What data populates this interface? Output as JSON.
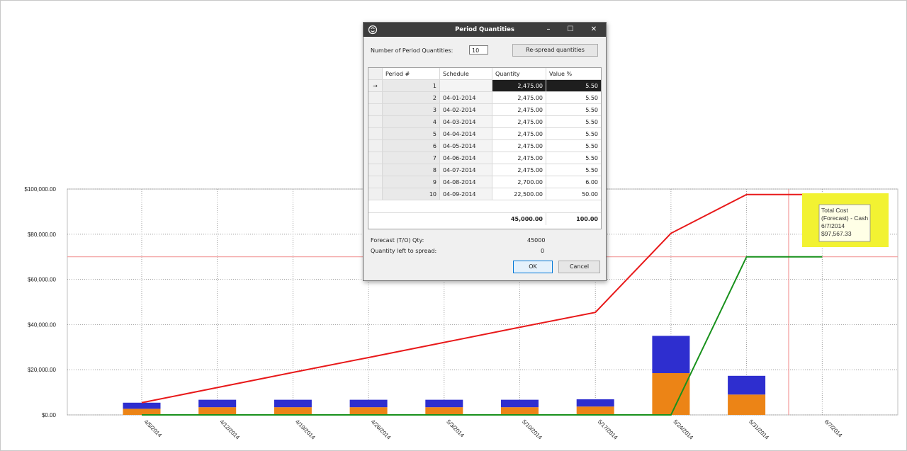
{
  "chart_data": {
    "type": "bar",
    "categories": [
      "4/5/2014",
      "4/12/2014",
      "4/19/2014",
      "4/26/2014",
      "5/3/2014",
      "5/10/2014",
      "5/17/2014",
      "5/24/2014",
      "5/31/2014",
      "6/7/2014"
    ],
    "series": [
      {
        "kind": "bar",
        "color": "#ec8416",
        "values": [
          2700,
          3400,
          3400,
          3400,
          3400,
          3400,
          3700,
          18500,
          9000,
          0
        ]
      },
      {
        "kind": "bar",
        "color": "#2e2ecf",
        "values": [
          2700,
          3300,
          3300,
          3300,
          3300,
          3300,
          3200,
          16500,
          8300,
          0
        ]
      },
      {
        "kind": "line",
        "color": "#e8191a",
        "values": [
          5400,
          12100,
          18800,
          25400,
          32100,
          38800,
          45400,
          80400,
          97567.33,
          97567.33
        ]
      },
      {
        "kind": "line",
        "color": "#18911c",
        "values": [
          0,
          0,
          0,
          0,
          0,
          0,
          0,
          0,
          70000,
          70000
        ]
      }
    ],
    "ylim": [
      0,
      100000
    ],
    "yticks": [
      "$0.00",
      "$20,000.00",
      "$40,000.00",
      "$60,000.00",
      "$80,000.00",
      "$100,000.00"
    ],
    "hline": 70000,
    "cursor_x": 9.6,
    "grid": true,
    "tooltip": {
      "lines": [
        "Total Cost",
        "(Forecast) - Cash",
        "6/7/2014",
        "$97,567.33"
      ],
      "bg": "#f2f232"
    }
  },
  "dialog": {
    "title": "Period Quantities",
    "icon": "app-logo-icon",
    "num_label": "Number of Period Quantities:",
    "num_value": "10",
    "respread_label": "Re-spread quantities",
    "columns": [
      "Period #",
      "Schedule",
      "Quantity",
      "Value %"
    ],
    "rows": [
      {
        "period": "1",
        "schedule": "",
        "quantity": "2,475.00",
        "value": "5.50"
      },
      {
        "period": "2",
        "schedule": "04-01-2014",
        "quantity": "2,475.00",
        "value": "5.50"
      },
      {
        "period": "3",
        "schedule": "04-02-2014",
        "quantity": "2,475.00",
        "value": "5.50"
      },
      {
        "period": "4",
        "schedule": "04-03-2014",
        "quantity": "2,475.00",
        "value": "5.50"
      },
      {
        "period": "5",
        "schedule": "04-04-2014",
        "quantity": "2,475.00",
        "value": "5.50"
      },
      {
        "period": "6",
        "schedule": "04-05-2014",
        "quantity": "2,475.00",
        "value": "5.50"
      },
      {
        "period": "7",
        "schedule": "04-06-2014",
        "quantity": "2,475.00",
        "value": "5.50"
      },
      {
        "period": "8",
        "schedule": "04-07-2014",
        "quantity": "2,475.00",
        "value": "5.50"
      },
      {
        "period": "9",
        "schedule": "04-08-2014",
        "quantity": "2,700.00",
        "value": "6.00"
      },
      {
        "period": "10",
        "schedule": "04-09-2014",
        "quantity": "22,500.00",
        "value": "50.00"
      }
    ],
    "row_indicator": "→",
    "total_quantity": "45,000.00",
    "total_value": "100.00",
    "forecast_label": "Forecast (T/O) Qty:",
    "forecast_value": "45000",
    "left_label": "Quantity left to spread:",
    "left_value": "0",
    "ok_label": "OK",
    "cancel_label": "Cancel",
    "minimize": "–",
    "maximize": "☐",
    "close": "✕"
  }
}
